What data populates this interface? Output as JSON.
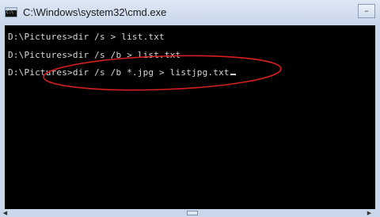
{
  "window": {
    "title": "C:\\Windows\\system32\\cmd.exe",
    "icon": "cmd-icon",
    "controls": {
      "minimize_icon": "minimize-icon",
      "maximize_icon": "maximize-icon",
      "close_icon": "close-icon"
    }
  },
  "console": {
    "lines": [
      "D:\\Pictures>dir /s > list.txt",
      "D:\\Pictures>dir /s /b > list.txt",
      "D:\\Pictures>dir /s /b *.jpg > listjpg.txt"
    ]
  },
  "colors": {
    "console_background": "#000000",
    "console_text": "#d8d8d8",
    "annotation_ellipse": "#d61f1f"
  }
}
